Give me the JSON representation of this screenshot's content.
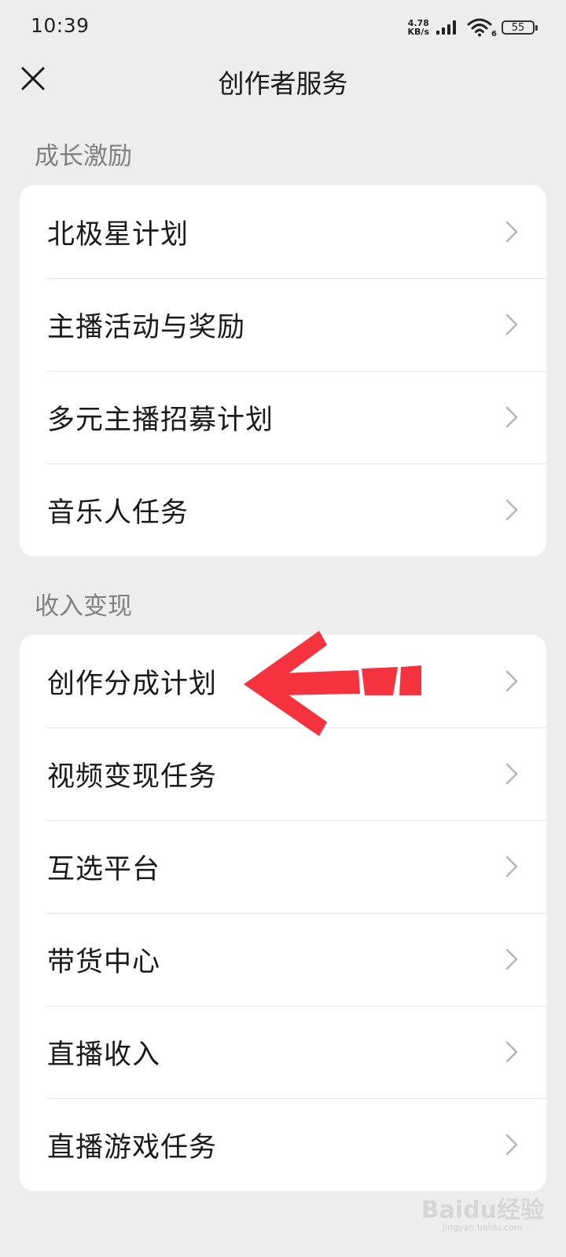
{
  "status_bar": {
    "time": "10:39",
    "net_speed_value": "4.78",
    "net_speed_unit": "KB/s",
    "wifi_badge": "6",
    "battery": "55"
  },
  "header": {
    "title": "创作者服务"
  },
  "sections": [
    {
      "title": "成长激励",
      "items": [
        "北极星计划",
        "主播活动与奖励",
        "多元主播招募计划",
        "音乐人任务"
      ]
    },
    {
      "title": "收入变现",
      "items": [
        "创作分成计划",
        "视频变现任务",
        "互选平台",
        "带货中心",
        "直播收入",
        "直播游戏任务"
      ]
    }
  ],
  "annotation": {
    "color": "#f5333f",
    "target": "创作分成计划"
  },
  "watermark": {
    "text": "Baidu经验",
    "sub": "jingyan.baidu.com"
  },
  "icons": {
    "close": "close-icon",
    "chevron": "chevron-right-icon",
    "signal": "signal-icon",
    "wifi": "wifi-icon",
    "battery": "battery-icon"
  }
}
